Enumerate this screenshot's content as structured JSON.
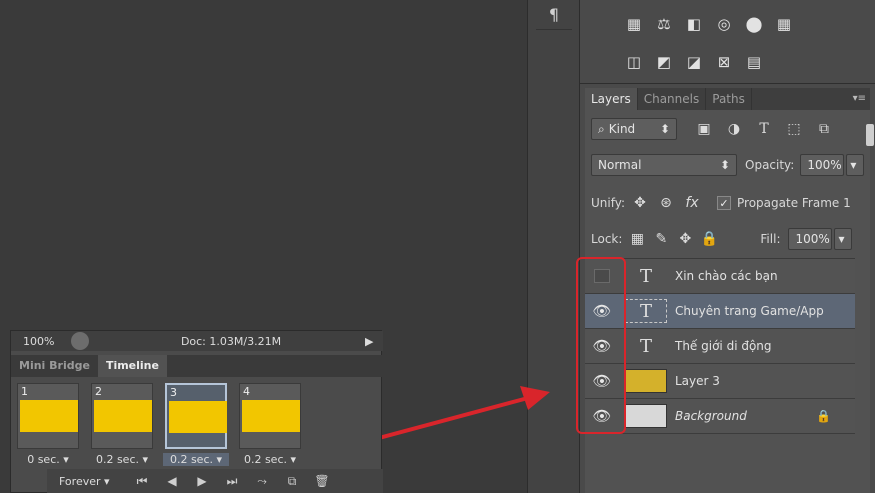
{
  "toolbar": {
    "paragraph_icon": "¶"
  },
  "adjustments": {
    "row1": [
      "▦",
      "⚖",
      "◧",
      "◎",
      "⬤",
      "▦"
    ],
    "row2": [
      "◫",
      "◩",
      "◪",
      "⊠",
      "▤"
    ]
  },
  "panel": {
    "tabs": [
      {
        "label": "Layers"
      },
      {
        "label": "Channels"
      },
      {
        "label": "Paths"
      }
    ],
    "menu_icon": "▾≡",
    "filter": {
      "label": "Kind",
      "icon": "⌕"
    },
    "blend_mode": "Normal",
    "opacity_label": "Opacity:",
    "opacity_value": "100%",
    "unify_label": "Unify:",
    "propagate_label": "Propagate Frame 1",
    "lock_label": "Lock:",
    "fill_label": "Fill:",
    "fill_value": "100%"
  },
  "layers": [
    {
      "name": "Xin chào các bạn",
      "type": "text",
      "visible": false
    },
    {
      "name": "Chuyên trang Game/App",
      "type": "text",
      "visible": true,
      "selected": true
    },
    {
      "name": "Thế giới di động",
      "type": "text",
      "visible": true
    },
    {
      "name": "Layer 3",
      "type": "image",
      "color": "#d4b12b",
      "visible": true
    },
    {
      "name": "Background",
      "type": "image",
      "color": "#d8d8d8",
      "visible": true,
      "locked": true
    }
  ],
  "status": {
    "zoom": "100%",
    "doc": "Doc: 1.03M/3.21M"
  },
  "timeline": {
    "tabs": [
      {
        "label": "Mini Bridge"
      },
      {
        "label": "Timeline"
      }
    ],
    "frames": [
      {
        "num": "1",
        "delay": "0 sec."
      },
      {
        "num": "2",
        "delay": "0.2 sec."
      },
      {
        "num": "3",
        "delay": "0.2 sec.",
        "selected": true
      },
      {
        "num": "4",
        "delay": "0.2 sec."
      }
    ],
    "loop": "Forever"
  },
  "colors": {
    "highlight": "#d9252b",
    "frame_fill": "#f2c600",
    "selection": "#5d6776"
  }
}
